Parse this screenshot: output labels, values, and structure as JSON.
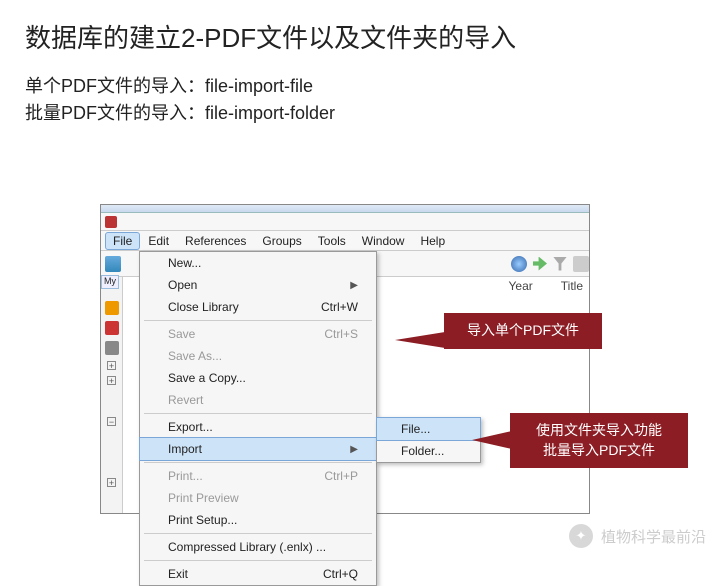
{
  "title": "数据库的建立2-PDF文件以及文件夹的导入",
  "desc_line1": "单个PDF文件的导入：file-import-file",
  "desc_line2": "批量PDF文件的导入：file-import-folder",
  "menubar": {
    "file": "File",
    "edit": "Edit",
    "references": "References",
    "groups": "Groups",
    "tools": "Tools",
    "window": "Window",
    "help": "Help"
  },
  "columns": {
    "year": "Year",
    "title": "Title"
  },
  "sidebar": {
    "my": "My"
  },
  "file_menu": {
    "new": "New...",
    "open": "Open",
    "close_library": "Close Library",
    "close_library_key": "Ctrl+W",
    "save": "Save",
    "save_key": "Ctrl+S",
    "save_as": "Save As...",
    "save_copy": "Save a Copy...",
    "revert": "Revert",
    "export": "Export...",
    "import": "Import",
    "print": "Print...",
    "print_key": "Ctrl+P",
    "print_preview": "Print Preview",
    "print_setup": "Print Setup...",
    "compressed": "Compressed Library (.enlx) ...",
    "exit": "Exit",
    "exit_key": "Ctrl+Q"
  },
  "submenu": {
    "file": "File...",
    "folder": "Folder..."
  },
  "callout1": "导入单个PDF文件",
  "callout2_l1": "使用文件夹导入功能",
  "callout2_l2": "批量导入PDF文件",
  "watermark": "植物科学最前沿"
}
